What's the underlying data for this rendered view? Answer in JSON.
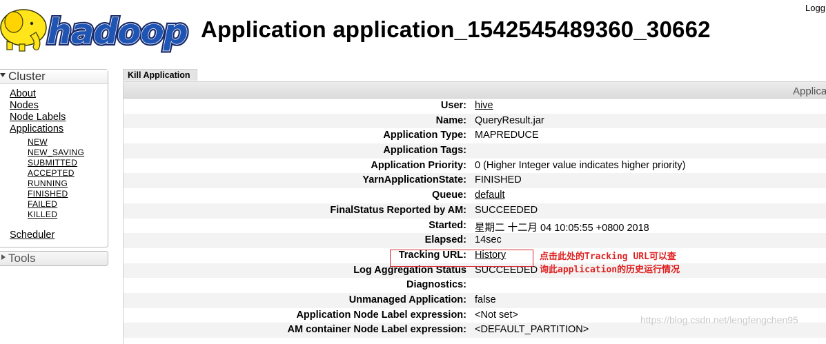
{
  "header": {
    "logo_text": "hadoop",
    "title": "Application application_1542545489360_30662",
    "logged_in": "Logg"
  },
  "sidebar": {
    "cluster": {
      "label": "Cluster",
      "items": [
        "About",
        "Nodes",
        "Node Labels",
        "Applications"
      ],
      "app_states": [
        "NEW",
        "NEW_SAVING",
        "SUBMITTED",
        "ACCEPTED",
        "RUNNING",
        "FINISHED",
        "FAILED",
        "KILLED"
      ],
      "scheduler": "Scheduler"
    },
    "tools": {
      "label": "Tools"
    }
  },
  "main": {
    "tab_label": "Kill Application",
    "section_header": "Applica",
    "rows": [
      {
        "key": "User:",
        "value": "hive",
        "link": true
      },
      {
        "key": "Name:",
        "value": "QueryResult.jar",
        "link": false
      },
      {
        "key": "Application Type:",
        "value": "MAPREDUCE",
        "link": false
      },
      {
        "key": "Application Tags:",
        "value": "",
        "link": false
      },
      {
        "key": "Application Priority:",
        "value": "0 (Higher Integer value indicates higher priority)",
        "link": false
      },
      {
        "key": "YarnApplicationState:",
        "value": "FINISHED",
        "link": false
      },
      {
        "key": "Queue:",
        "value": "default",
        "link": true
      },
      {
        "key": "FinalStatus Reported by AM:",
        "value": "SUCCEEDED",
        "link": false
      },
      {
        "key": "Started:",
        "value": "星期二 十二月 04 10:05:55 +0800 2018",
        "link": false
      },
      {
        "key": "Elapsed:",
        "value": "14sec",
        "link": false
      },
      {
        "key": "Tracking URL:",
        "value": "History",
        "link": true
      },
      {
        "key": "Log Aggregation Status",
        "value": "SUCCEEDED",
        "link": false
      },
      {
        "key": "Diagnostics:",
        "value": "",
        "link": false
      },
      {
        "key": "Unmanaged Application:",
        "value": "false",
        "link": false
      },
      {
        "key": "Application Node Label expression:",
        "value": "<Not set>",
        "link": false
      },
      {
        "key": "AM container Node Label expression:",
        "value": "<DEFAULT_PARTITION>",
        "link": false
      }
    ]
  },
  "annotation": {
    "line1": "点击此处的Tracking URL可以查",
    "line2": "询此application的历史运行情况",
    "color": "#e02020"
  },
  "watermark": "https://blog.csdn.net/lengfengchen95"
}
